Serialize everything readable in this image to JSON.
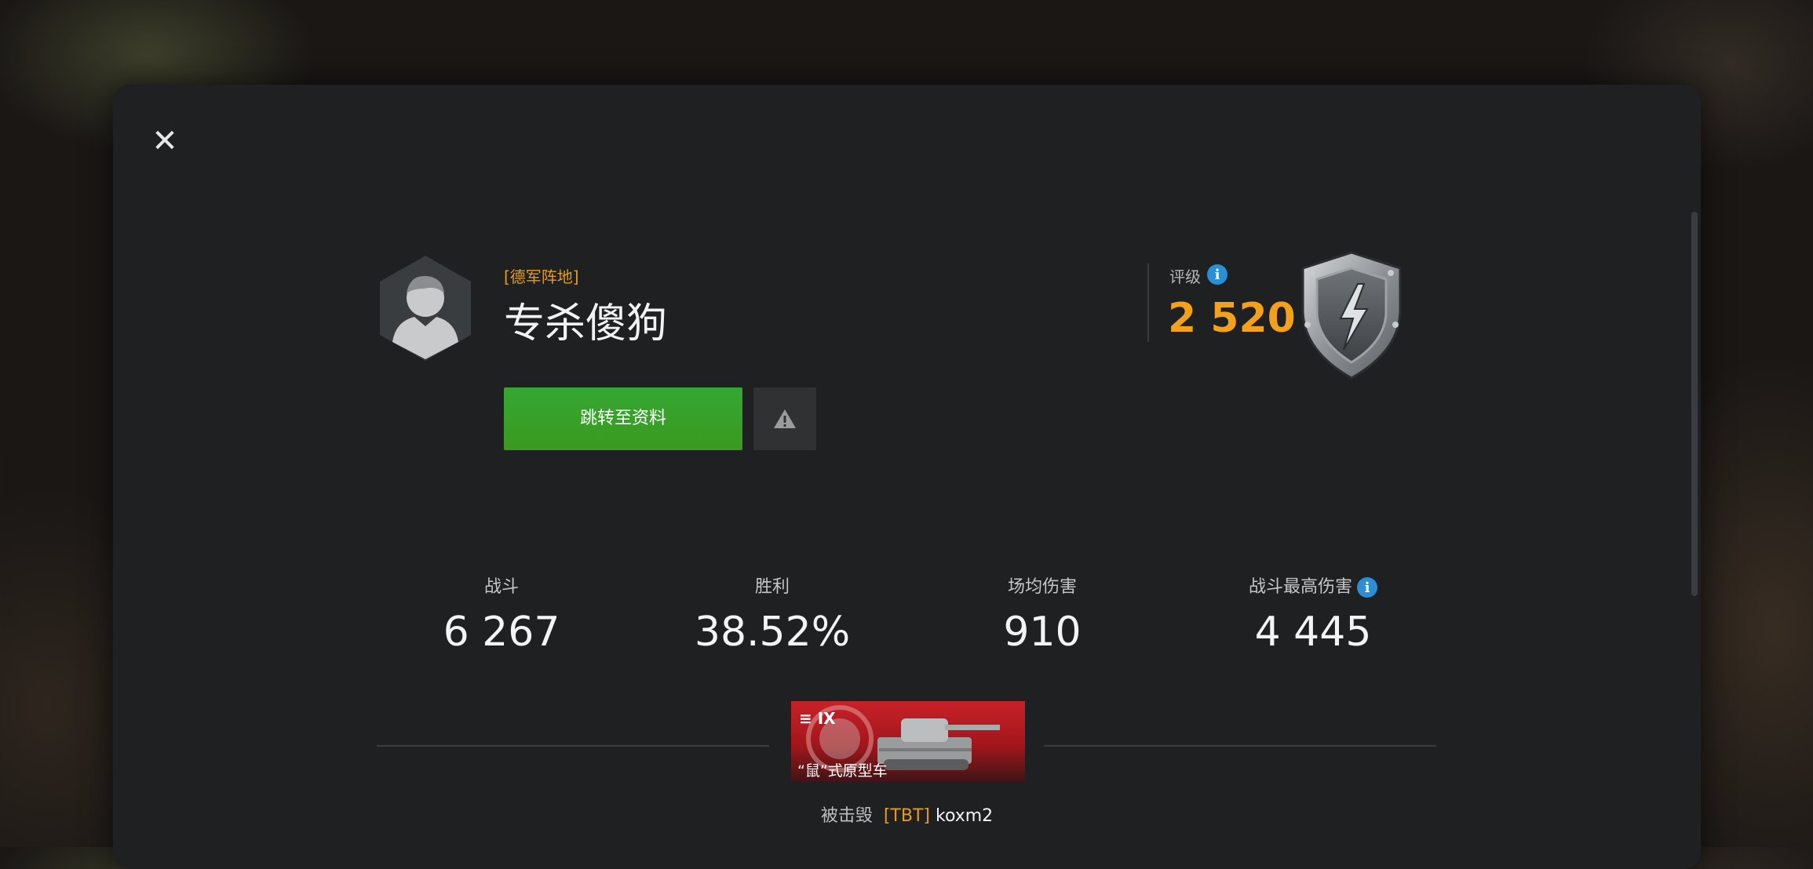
{
  "player": {
    "clan_tag": "[德军阵地]",
    "nickname": "专杀傻狗"
  },
  "actions": {
    "profile_button": "跳转至资料",
    "report_icon": "warning-icon"
  },
  "rating": {
    "label": "评级",
    "value": "2 520",
    "icon": "info-icon"
  },
  "stats": [
    {
      "label": "战斗",
      "value": "6 267"
    },
    {
      "label": "胜利",
      "value": "38.52%"
    },
    {
      "label": "场均伤害",
      "value": "910"
    },
    {
      "label": "战斗最高伤害",
      "value": "4 445"
    }
  ],
  "tank": {
    "tier": "IX",
    "name": "“鼠”式原型车"
  },
  "destroyed_by": {
    "prefix": "被击毁",
    "clan": "[TBT]",
    "player": "koxm2"
  },
  "colors": {
    "accent_orange": "#f3a11a",
    "button_green": "#34a733",
    "info_blue": "#2a8fd6",
    "panel_bg": "#1e2022"
  }
}
